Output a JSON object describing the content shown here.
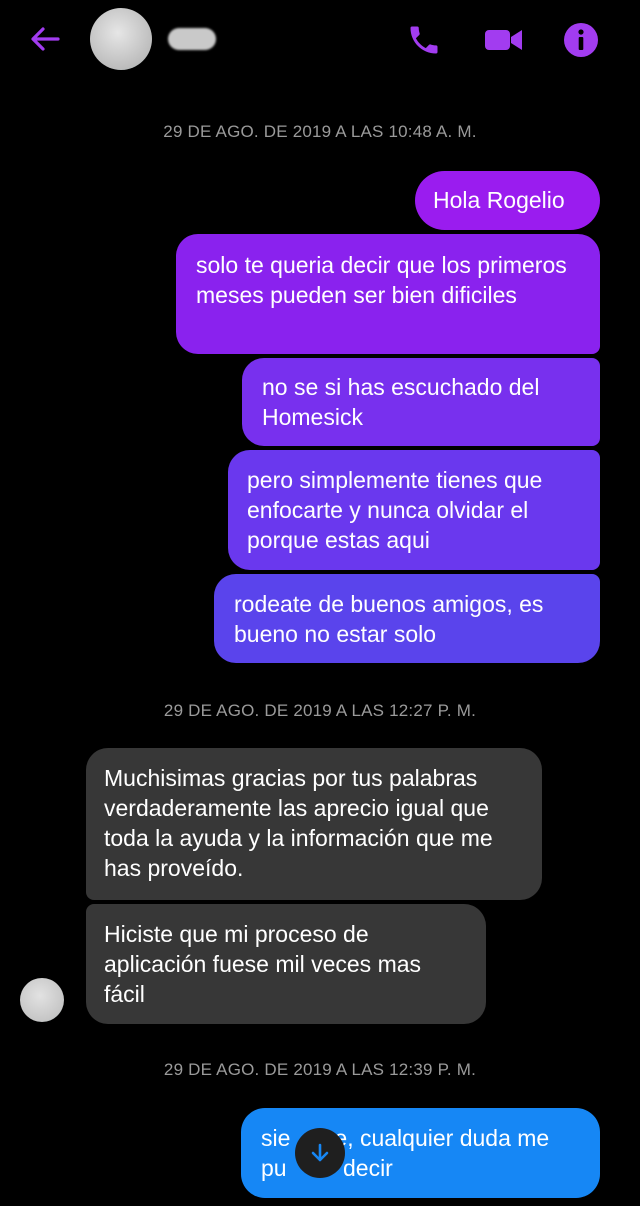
{
  "header": {
    "accent_color": "#a23cf0",
    "icons": [
      "back-arrow-icon",
      "phone-icon",
      "video-camera-icon",
      "info-icon"
    ]
  },
  "timestamps": [
    "29 DE AGO. DE 2019 A LAS 10:48 A. M.",
    "29 DE AGO. DE 2019 A LAS 12:27 P. M.",
    "29 DE AGO. DE 2019 A LAS 12:39 P. M."
  ],
  "messages": [
    {
      "direction": "outgoing",
      "text": "Hola Rogelio",
      "color": "#9a1cef"
    },
    {
      "direction": "outgoing",
      "text": "solo te queria decir que los primeros meses pueden ser bien dificiles",
      "color": "#8a22ee"
    },
    {
      "direction": "outgoing",
      "text": "no se si has escuchado  del Homesick",
      "color": "#7830ee"
    },
    {
      "direction": "outgoing",
      "text": "pero simplemente tienes que enfocarte y nunca olvidar el porque estas aqui",
      "color": "#6a38ee"
    },
    {
      "direction": "outgoing",
      "text": "rodeate de buenos amigos, es bueno no estar solo",
      "color": "#5a44ec"
    },
    {
      "direction": "incoming",
      "text": "Muchisimas gracias por tus palabras verdaderamente las aprecio igual que toda la ayuda y la información que me has proveído.",
      "color": "#373737"
    },
    {
      "direction": "incoming",
      "text": "Hiciste que mi proceso de aplicación fuese mil veces mas fácil",
      "color": "#373737"
    },
    {
      "direction": "outgoing",
      "text_before": "sie",
      "text_after": "e, cualquier duda me",
      "text_line2_before": "pu",
      "text_line2_after": " decir",
      "color": "#1687f5"
    }
  ],
  "scroll_button": {
    "icon": "arrow-down-icon"
  }
}
